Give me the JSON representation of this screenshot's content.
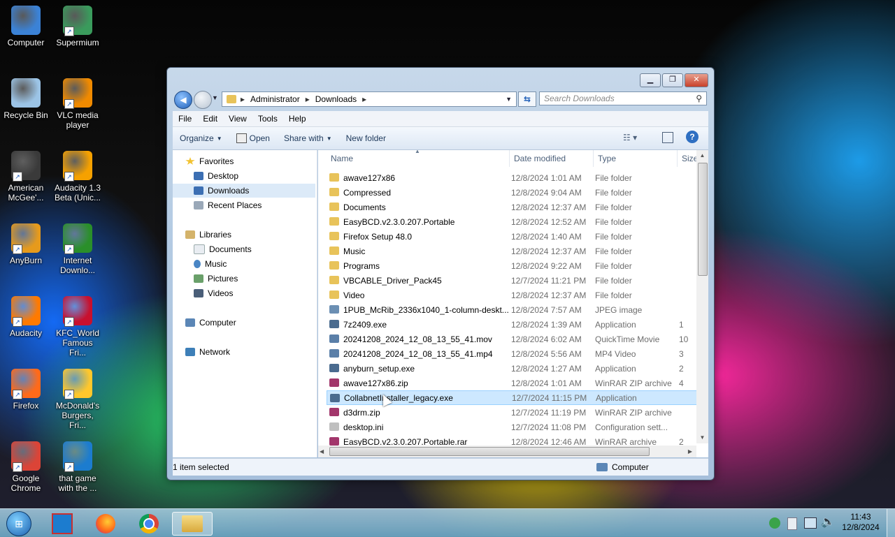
{
  "desktop_icons": [
    {
      "label": "Computer",
      "icon": "computer-icon",
      "color": "#3b82d6"
    },
    {
      "label": "Supermium",
      "icon": "supermium-icon",
      "color": "#3a9b5c"
    },
    {
      "label": "Recycle Bin",
      "icon": "recycle-bin-icon",
      "color": "#9cc4e6"
    },
    {
      "label": "VLC media player",
      "icon": "vlc-icon",
      "color": "#f08a00"
    },
    {
      "label": "American McGee'...",
      "icon": "american-mcgee-icon",
      "color": "#3a3a3a"
    },
    {
      "label": "Audacity 1.3 Beta (Unic...",
      "icon": "audacity-icon",
      "color": "#f6a100"
    },
    {
      "label": "AnyBurn",
      "icon": "anyburn-icon",
      "color": "#e69a1c"
    },
    {
      "label": "Internet Downlo...",
      "icon": "internet-download-manager-icon",
      "color": "#2a8f2a"
    },
    {
      "label": "Audacity",
      "icon": "audacity-icon",
      "color": "#ff7a00"
    },
    {
      "label": "KFC_World Famous Fri...",
      "icon": "kfc-icon",
      "color": "#c8102e"
    },
    {
      "label": "Firefox",
      "icon": "firefox-icon",
      "color": "#ff6a1a"
    },
    {
      "label": "McDonald's Burgers, Fri...",
      "icon": "mcdonalds-icon",
      "color": "#ffc72c"
    },
    {
      "label": "Google Chrome",
      "icon": "chrome-icon",
      "color": "#db4437"
    },
    {
      "label": "that game with the ...",
      "icon": "game-icon",
      "color": "#1c7ccf"
    }
  ],
  "window": {
    "address": {
      "segments": [
        "Administrator",
        "Downloads"
      ]
    },
    "search_placeholder": "Search Downloads",
    "menu": [
      "File",
      "Edit",
      "View",
      "Tools",
      "Help"
    ],
    "toolbar": {
      "organize": "Organize",
      "open": "Open",
      "share_with": "Share with",
      "new_folder": "New folder"
    },
    "nav": {
      "favorites": "Favorites",
      "favorites_items": [
        "Desktop",
        "Downloads",
        "Recent Places"
      ],
      "libraries": "Libraries",
      "libraries_items": [
        "Documents",
        "Music",
        "Pictures",
        "Videos"
      ],
      "computer": "Computer",
      "network": "Network"
    },
    "columns": [
      "Name",
      "Date modified",
      "Type",
      "Size"
    ],
    "files": [
      {
        "name": "awave127x86",
        "date": "12/8/2024 1:01 AM",
        "type": "File folder",
        "size": "",
        "kind": "folder"
      },
      {
        "name": "Compressed",
        "date": "12/8/2024 9:04 AM",
        "type": "File folder",
        "size": "",
        "kind": "folder"
      },
      {
        "name": "Documents",
        "date": "12/8/2024 12:37 AM",
        "type": "File folder",
        "size": "",
        "kind": "folder"
      },
      {
        "name": "EasyBCD.v2.3.0.207.Portable",
        "date": "12/8/2024 12:52 AM",
        "type": "File folder",
        "size": "",
        "kind": "folder"
      },
      {
        "name": "Firefox Setup 48.0",
        "date": "12/8/2024 1:40 AM",
        "type": "File folder",
        "size": "",
        "kind": "folder"
      },
      {
        "name": "Music",
        "date": "12/8/2024 12:37 AM",
        "type": "File folder",
        "size": "",
        "kind": "folder"
      },
      {
        "name": "Programs",
        "date": "12/8/2024 9:22 AM",
        "type": "File folder",
        "size": "",
        "kind": "folder"
      },
      {
        "name": "VBCABLE_Driver_Pack45",
        "date": "12/7/2024 11:21 PM",
        "type": "File folder",
        "size": "",
        "kind": "folder"
      },
      {
        "name": "Video",
        "date": "12/8/2024 12:37 AM",
        "type": "File folder",
        "size": "",
        "kind": "folder"
      },
      {
        "name": "1PUB_McRib_2336x1040_1-column-deskt...",
        "date": "12/8/2024 7:57 AM",
        "type": "JPEG image",
        "size": "",
        "kind": "image"
      },
      {
        "name": "7z2409.exe",
        "date": "12/8/2024 1:39 AM",
        "type": "Application",
        "size": "1",
        "kind": "app"
      },
      {
        "name": "20241208_2024_12_08_13_55_41.mov",
        "date": "12/8/2024 6:02 AM",
        "type": "QuickTime Movie",
        "size": "10",
        "kind": "video"
      },
      {
        "name": "20241208_2024_12_08_13_55_41.mp4",
        "date": "12/8/2024 5:56 AM",
        "type": "MP4 Video",
        "size": "3",
        "kind": "video"
      },
      {
        "name": "anyburn_setup.exe",
        "date": "12/8/2024 1:27 AM",
        "type": "Application",
        "size": "2",
        "kind": "app"
      },
      {
        "name": "awave127x86.zip",
        "date": "12/8/2024 1:01 AM",
        "type": "WinRAR ZIP archive",
        "size": "4",
        "kind": "archive"
      },
      {
        "name": "CollabnetInstaller_legacy.exe",
        "date": "12/7/2024 11:15 PM",
        "type": "Application",
        "size": "",
        "kind": "app",
        "selected": true
      },
      {
        "name": "d3drm.zip",
        "date": "12/7/2024 11:19 PM",
        "type": "WinRAR ZIP archive",
        "size": "",
        "kind": "archive"
      },
      {
        "name": "desktop.ini",
        "date": "12/7/2024 11:08 PM",
        "type": "Configuration sett...",
        "size": "",
        "kind": "config"
      },
      {
        "name": "EasyBCD.v2.3.0.207.Portable.rar",
        "date": "12/8/2024 12:46 AM",
        "type": "WinRAR archive",
        "size": "2",
        "kind": "archive"
      }
    ],
    "status_left": "1 item selected",
    "status_right": "Computer"
  },
  "taskbar": {
    "time": "11:43",
    "date": "12/8/2024"
  },
  "colors": {
    "folder": "#e8c35a",
    "archive": "#a2366b",
    "app": "#4a6b8f",
    "video": "#5a7fa8",
    "image": "#6b8fb3",
    "config": "#bfbfbf",
    "selection": "#cde8ff"
  }
}
